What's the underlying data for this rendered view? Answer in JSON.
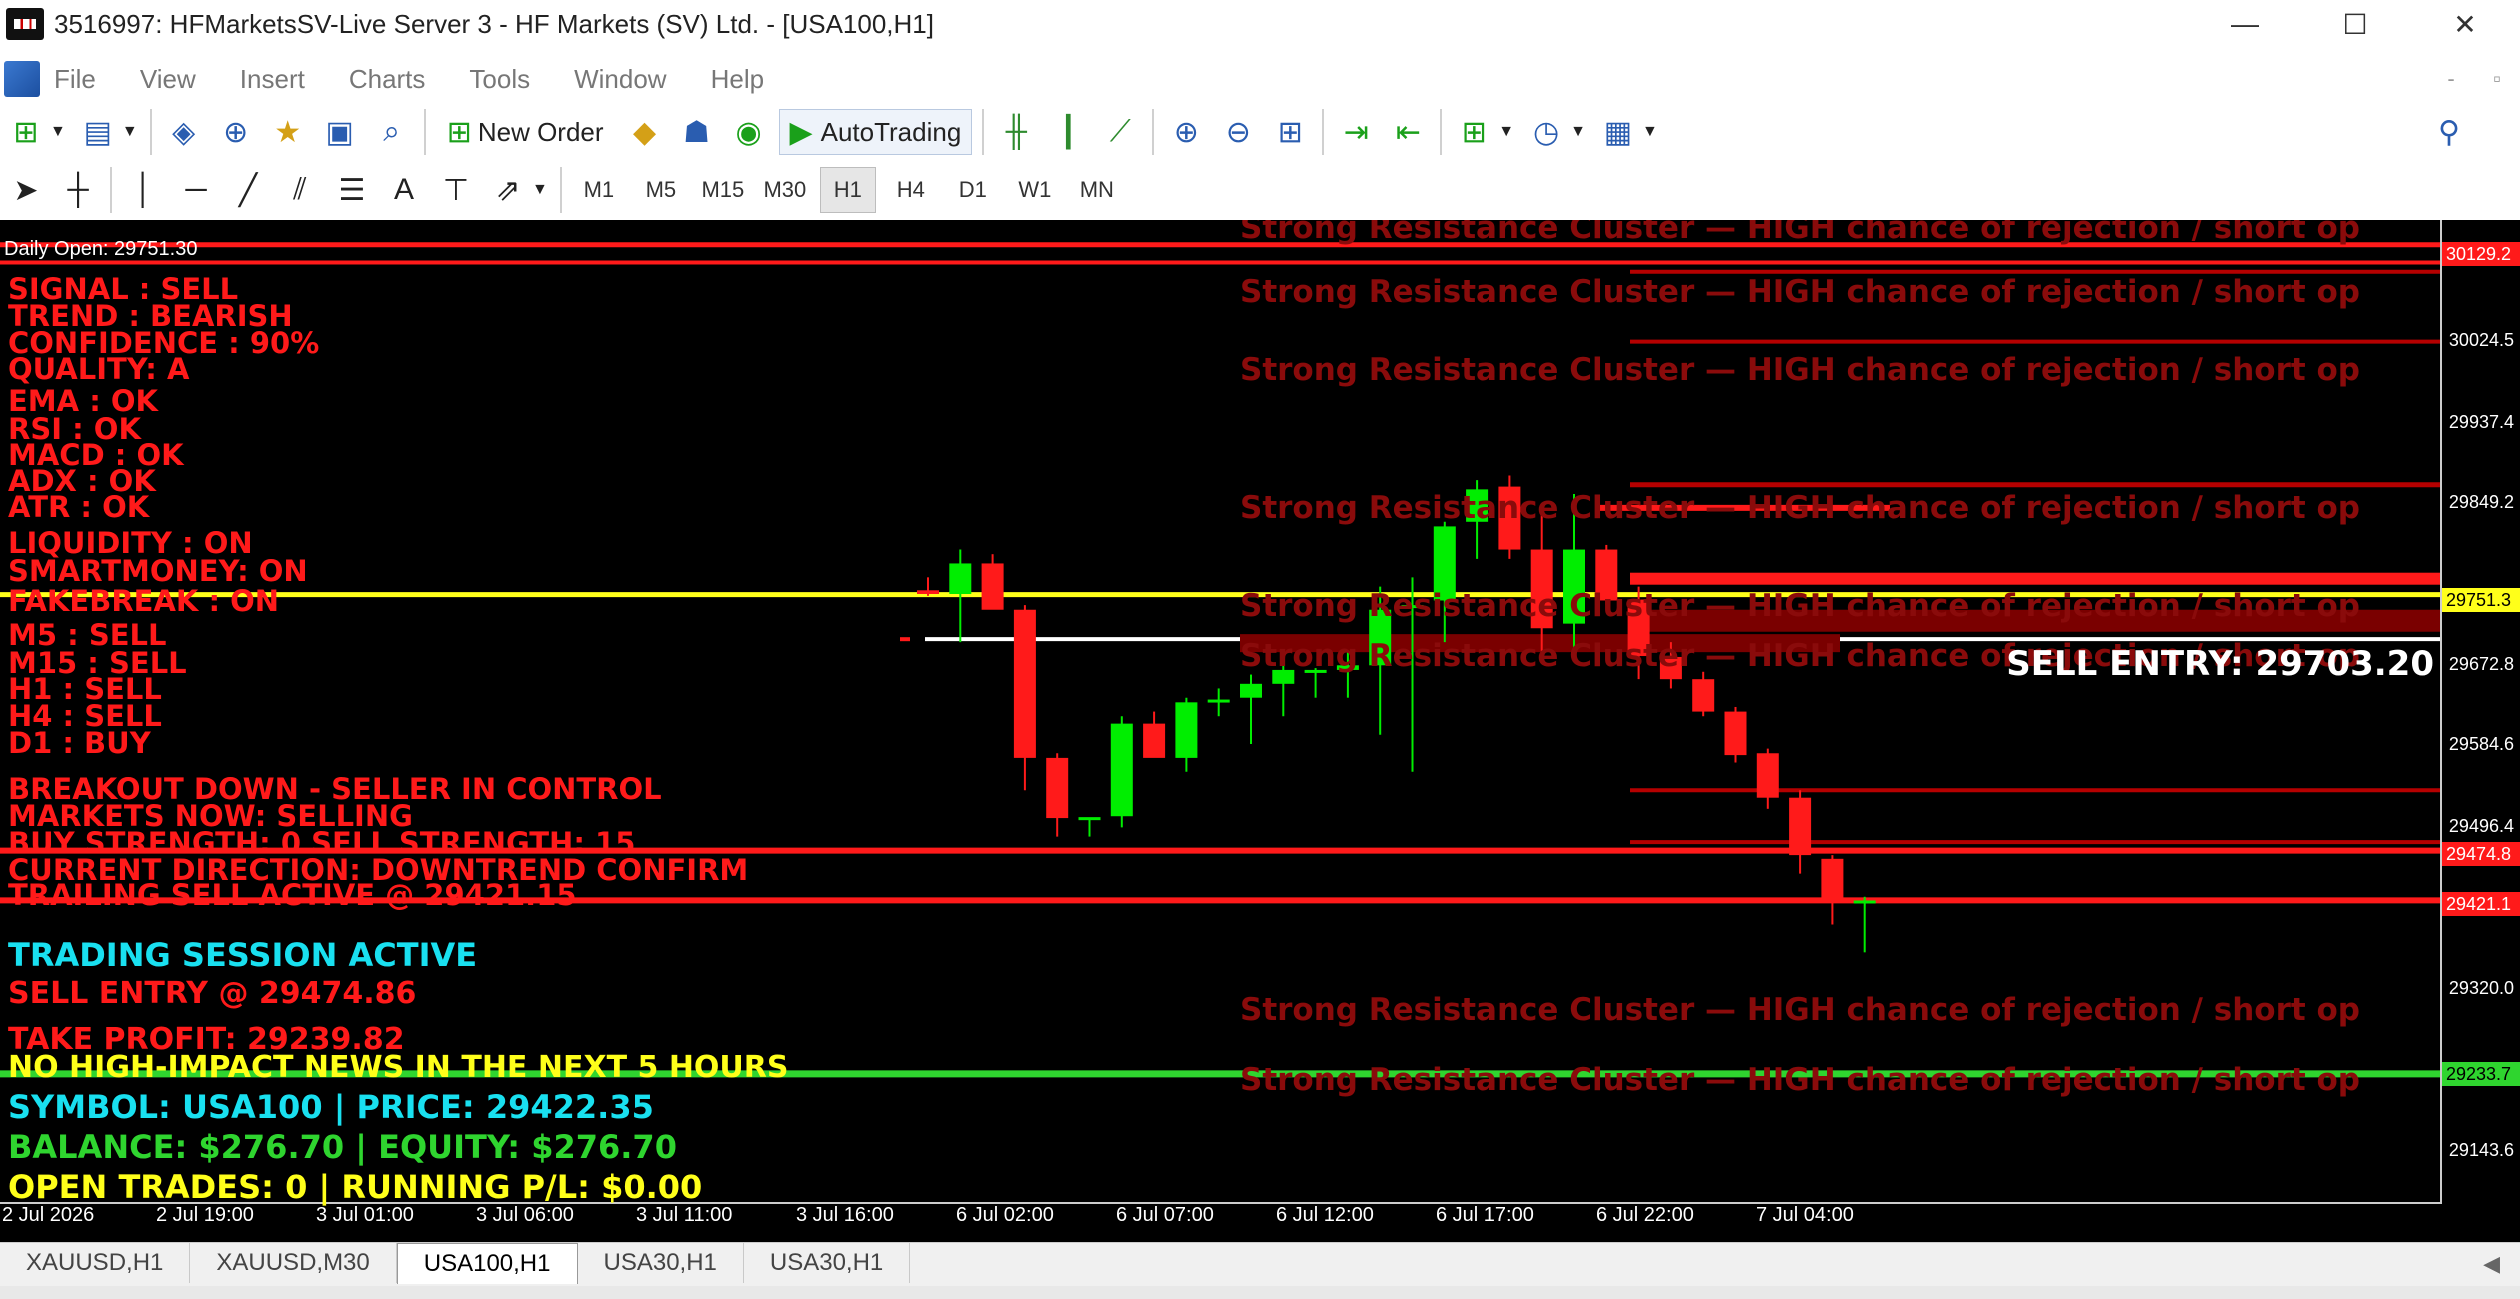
{
  "window": {
    "title": "3516997: HFMarketsSV-Live Server 3 - HF Markets (SV) Ltd. - [USA100,H1]",
    "controls": {
      "minimize": "—",
      "maximize": "☐",
      "close": "✕"
    }
  },
  "menu": {
    "items": [
      "File",
      "View",
      "Insert",
      "Charts",
      "Tools",
      "Window",
      "Help"
    ],
    "mdi_minimize": "-",
    "mdi_restore": "▫"
  },
  "toolbar": {
    "new_order_label": "New Order",
    "autotrading_label": "AutoTrading",
    "timeframes": [
      "M1",
      "M5",
      "M15",
      "M30",
      "H1",
      "H4",
      "D1",
      "W1",
      "MN"
    ],
    "active_timeframe": "H1"
  },
  "chart": {
    "daily_open": "Daily Open: 29751.30",
    "signals": [
      "SIGNAL : SELL",
      "TREND  : BEARISH",
      "CONFIDENCE  : 90%",
      "QUALITY: A",
      "EMA    : OK",
      "RSI    : OK",
      "MACD   : OK",
      "ADX    : OK",
      "ATR    : OK",
      "LIQUIDITY : ON",
      "SMARTMONEY: ON",
      "FAKEBREAK : ON",
      "M5  : SELL",
      "M15 : SELL",
      "H1  : SELL",
      "H4  : SELL",
      "D1  : BUY",
      "BREAKOUT DOWN - SELLER IN CONTROL",
      "MARKETS NOW: SELLING",
      "BUY STRENGTH: 0   SELL STRENGTH: 15",
      "CURRENT DIRECTION: DOWNTREND CONFIRM",
      "TRAILING SELL ACTIVE @ 29421.15"
    ],
    "session": "TRADING SESSION ACTIVE",
    "sell_entry": " SELL ENTRY @ 29474.86",
    "take_profit": "TAKE PROFIT: 29239.82",
    "news": "NO HIGH-IMPACT NEWS IN THE NEXT 5 HOURS",
    "symbol_line": "SYMBOL: USA100 | PRICE: 29422.35",
    "balance_line": "BALANCE: $276.70 | EQUITY: $276.70",
    "trades_line": "OPEN TRADES: 0 | RUNNING P/L: $0.00",
    "resistance_text": "Strong Resistance Cluster — HIGH chance of rejection / short op",
    "sell_entry_label": "SELL ENTRY: 29703.20",
    "price_axis": [
      "30024.5",
      "29937.4",
      "29849.2",
      "29672.8",
      "29584.6",
      "29496.4",
      "29320.0",
      "29143.6"
    ],
    "price_axis_highlights": [
      {
        "text": "30129.2",
        "color": "#ff1a1a"
      },
      {
        "text": "29751.3",
        "color": "#ffff1a"
      },
      {
        "text": "29474.8",
        "color": "#ff1a1a"
      },
      {
        "text": "29421.1",
        "color": "#ff1a1a"
      },
      {
        "text": "29233.7",
        "color": "#2fd52f"
      }
    ],
    "time_axis": [
      "2 Jul 2026",
      "2 Jul 19:00",
      "3 Jul 01:00",
      "3 Jul 06:00",
      "3 Jul 11:00",
      "3 Jul 16:00",
      "6 Jul 02:00",
      "6 Jul 07:00",
      "6 Jul 12:00",
      "6 Jul 17:00",
      "6 Jul 22:00",
      "7 Jul 04:00"
    ],
    "candles": [
      {
        "o": 29756,
        "h": 29770,
        "l": 29750,
        "c": 29752
      },
      {
        "o": 29752,
        "h": 29800,
        "l": 29700,
        "c": 29785
      },
      {
        "o": 29785,
        "h": 29795,
        "l": 29740,
        "c": 29735
      },
      {
        "o": 29735,
        "h": 29740,
        "l": 29540,
        "c": 29575
      },
      {
        "o": 29575,
        "h": 29580,
        "l": 29490,
        "c": 29510
      },
      {
        "o": 29510,
        "h": 29510,
        "l": 29490,
        "c": 29511
      },
      {
        "o": 29512,
        "h": 29620,
        "l": 29500,
        "c": 29612
      },
      {
        "o": 29612,
        "h": 29625,
        "l": 29580,
        "c": 29575
      },
      {
        "o": 29575,
        "h": 29640,
        "l": 29560,
        "c": 29635
      },
      {
        "o": 29635,
        "h": 29650,
        "l": 29620,
        "c": 29638
      },
      {
        "o": 29640,
        "h": 29665,
        "l": 29590,
        "c": 29655
      },
      {
        "o": 29655,
        "h": 29685,
        "l": 29620,
        "c": 29670
      },
      {
        "o": 29668,
        "h": 29672,
        "l": 29640,
        "c": 29670
      },
      {
        "o": 29670,
        "h": 29690,
        "l": 29640,
        "c": 29675
      },
      {
        "o": 29675,
        "h": 29760,
        "l": 29600,
        "c": 29735
      },
      {
        "o": 29738,
        "h": 29770,
        "l": 29560,
        "c": 29740
      },
      {
        "o": 29745,
        "h": 29830,
        "l": 29700,
        "c": 29825
      },
      {
        "o": 29830,
        "h": 29875,
        "l": 29790,
        "c": 29865
      },
      {
        "o": 29868,
        "h": 29880,
        "l": 29790,
        "c": 29800
      },
      {
        "o": 29800,
        "h": 29840,
        "l": 29690,
        "c": 29715
      },
      {
        "o": 29720,
        "h": 29860,
        "l": 29690,
        "c": 29800
      },
      {
        "o": 29800,
        "h": 29805,
        "l": 29740,
        "c": 29745
      },
      {
        "o": 29746,
        "h": 29760,
        "l": 29660,
        "c": 29685
      },
      {
        "o": 29684,
        "h": 29700,
        "l": 29650,
        "c": 29660
      },
      {
        "o": 29660,
        "h": 29668,
        "l": 29620,
        "c": 29625
      },
      {
        "o": 29625,
        "h": 29630,
        "l": 29570,
        "c": 29578
      },
      {
        "o": 29580,
        "h": 29585,
        "l": 29520,
        "c": 29532
      },
      {
        "o": 29532,
        "h": 29540,
        "l": 29450,
        "c": 29470
      },
      {
        "o": 29466,
        "h": 29470,
        "l": 29395,
        "c": 29420
      },
      {
        "o": 29420,
        "h": 29425,
        "l": 29365,
        "c": 29421
      }
    ],
    "tabs": [
      "XAUUSD,H1",
      "XAUUSD,M30",
      "USA100,H1",
      "USA30,H1",
      "USA30,H1"
    ],
    "active_tab": "USA100,H1",
    "colors": {
      "bull": "#00ee00",
      "bear": "#ff1a1a",
      "resistance": "#8a0b0b"
    }
  }
}
